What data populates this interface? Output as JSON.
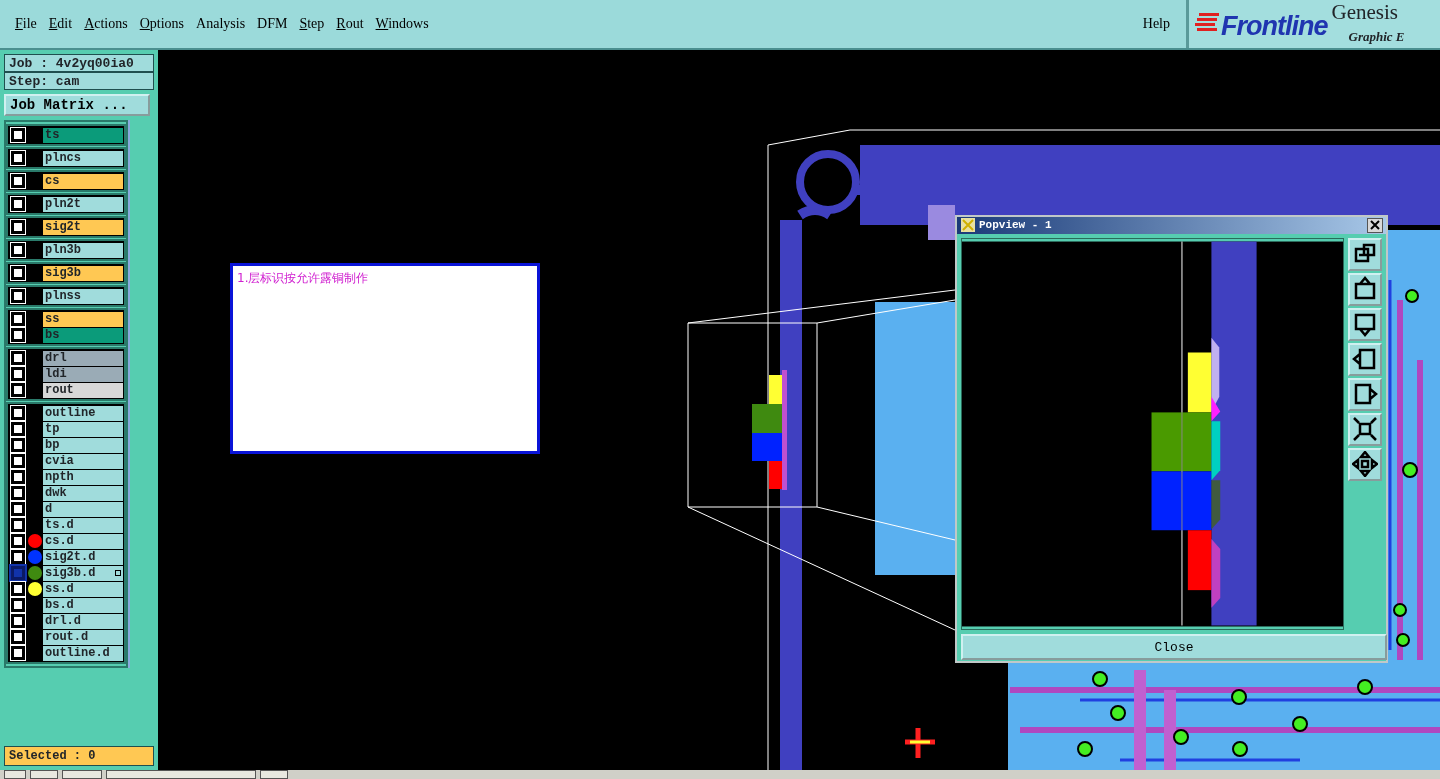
{
  "menu": [
    {
      "label": "File",
      "mnemonic": true
    },
    {
      "label": "Edit",
      "mnemonic": true
    },
    {
      "label": "Actions",
      "mnemonic": true
    },
    {
      "label": "Options",
      "mnemonic": true
    },
    {
      "label": "Analysis",
      "mnemonic": false
    },
    {
      "label": "DFM",
      "mnemonic": false
    },
    {
      "label": "Step",
      "mnemonic": true
    },
    {
      "label": "Rout",
      "mnemonic": true
    },
    {
      "label": "Windows",
      "mnemonic": true
    }
  ],
  "help": "Help",
  "logo": {
    "brand": "Frontline",
    "product": "Genesis",
    "subtitle": "Graphic E"
  },
  "job": "Job : 4v2yq00ia0",
  "step": "Step: cam",
  "job_matrix_button": "Job Matrix ...",
  "layer_groups": [
    [
      {
        "name": "ts",
        "color": "#0b9b7a",
        "selected": false
      }
    ],
    [
      {
        "name": "plncs",
        "color": "#a0dcdc",
        "selected": false
      }
    ],
    [
      {
        "name": "cs",
        "color": "#ffc853",
        "selected": false
      }
    ],
    [
      {
        "name": "pln2t",
        "color": "#a0dcdc",
        "selected": false
      }
    ],
    [
      {
        "name": "sig2t",
        "color": "#ffc853",
        "selected": false
      }
    ],
    [
      {
        "name": "pln3b",
        "color": "#a0dcdc",
        "selected": false
      }
    ],
    [
      {
        "name": "sig3b",
        "color": "#ffc853",
        "selected": false
      }
    ],
    [
      {
        "name": "plnss",
        "color": "#a0dcdc",
        "selected": false
      }
    ],
    [
      {
        "name": "ss",
        "color": "#ffc853",
        "selected": false
      },
      {
        "name": "bs",
        "color": "#0b9b7a",
        "selected": false
      }
    ],
    [
      {
        "name": "drl",
        "color": "#9aabb6",
        "selected": false
      },
      {
        "name": "ldi",
        "color": "#9aabb6",
        "selected": false
      },
      {
        "name": "rout",
        "color": "#d8d8d8",
        "selected": false
      }
    ],
    [
      {
        "name": "outline",
        "color": "#a0dcdc",
        "selected": false
      },
      {
        "name": "tp",
        "color": "#a0dcdc",
        "selected": false
      },
      {
        "name": "bp",
        "color": "#a0dcdc",
        "selected": false
      },
      {
        "name": "cvia",
        "color": "#a0dcdc",
        "selected": false
      },
      {
        "name": "npth",
        "color": "#a0dcdc",
        "selected": false
      },
      {
        "name": "dwk",
        "color": "#a0dcdc",
        "selected": false
      },
      {
        "name": "d",
        "color": "#a0dcdc",
        "selected": false
      },
      {
        "name": "ts.d",
        "color": "#a0dcdc",
        "selected": false
      },
      {
        "name": "cs.d",
        "color": "#a0dcdc",
        "selected": false,
        "marker": {
          "color": "#ff0000"
        }
      },
      {
        "name": "sig2t.d",
        "color": "#a0dcdc",
        "selected": false,
        "marker": {
          "color": "#0033ff"
        }
      },
      {
        "name": "sig3b.d",
        "color": "#a0dcdc",
        "selected": true,
        "marker": {
          "color": "#3f8a10"
        }
      },
      {
        "name": "ss.d",
        "color": "#a0dcdc",
        "selected": false,
        "marker": {
          "color": "#ffff33"
        }
      },
      {
        "name": "bs.d",
        "color": "#a0dcdc",
        "selected": false
      },
      {
        "name": "drl.d",
        "color": "#a0dcdc",
        "selected": false
      },
      {
        "name": "rout.d",
        "color": "#a0dcdc",
        "selected": false
      },
      {
        "name": "outline.d",
        "color": "#a0dcdc",
        "selected": false
      }
    ]
  ],
  "status": "Selected : 0",
  "note": "1.层标识按允许露铜制作",
  "popview": {
    "title": "Popview - 1",
    "close_button": "Close"
  }
}
